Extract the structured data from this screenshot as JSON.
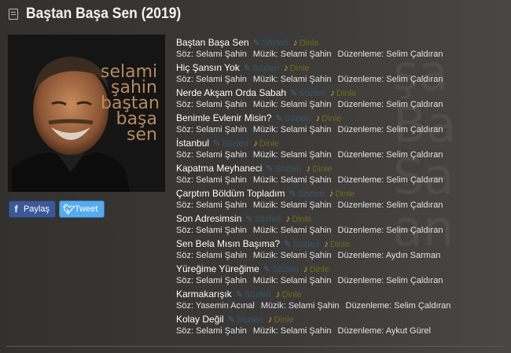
{
  "album": {
    "title": "Baştan Başa Sen (2019)",
    "cover_lines": [
      "selami",
      "şahin",
      "baştan",
      "başa",
      "sen"
    ],
    "background_lines": [
      "şa",
      "Ba",
      "Sa",
      "an"
    ]
  },
  "share": {
    "facebook_label": "Paylaş",
    "twitter_label": "Tweet"
  },
  "labels": {
    "lyrics": "Sözleri",
    "listen": "Dinle"
  },
  "tracks": [
    {
      "title": "Baştan Başa Sen",
      "soz": "Söz: Selami Şahin",
      "muzik": "Müzik: Selami Şahin",
      "duzenleme": "Düzenleme: Selim Çaldıran"
    },
    {
      "title": "Hiç Şansın Yok",
      "soz": "Söz: Selami Şahin",
      "muzik": "Müzik: Selami Şahin",
      "duzenleme": "Düzenleme: Selim Çaldıran"
    },
    {
      "title": "Nerde Akşam Orda Sabah",
      "soz": "Söz: Selami Şahin",
      "muzik": "Müzik: Selami Şahin",
      "duzenleme": "Düzenleme: Selim Çaldıran"
    },
    {
      "title": "Benimle Evlenir Misin?",
      "soz": "Söz: Selami Şahin",
      "muzik": "Müzik: Selami Şahin",
      "duzenleme": "Düzenleme: Selim Çaldıran"
    },
    {
      "title": "İstanbul",
      "soz": "Söz: Selami Şahin",
      "muzik": "Müzik: Selami Şahin",
      "duzenleme": "Düzenleme: Selim Çaldıran"
    },
    {
      "title": "Kapatma Meyhaneci",
      "soz": "Söz: Selami Şahin",
      "muzik": "Müzik: Selami Şahin",
      "duzenleme": "Düzenleme: Selim Çaldıran"
    },
    {
      "title": "Çarptım Böldüm Topladım",
      "soz": "Söz: Selami Şahin",
      "muzik": "Müzik: Selami Şahin",
      "duzenleme": "Düzenleme: Selim Çaldıran"
    },
    {
      "title": "Son Adresimsin",
      "soz": "Söz: Selami Şahin",
      "muzik": "Müzik: Selami Şahin",
      "duzenleme": "Düzenleme: Selim Çaldıran"
    },
    {
      "title": "Sen Bela Mısın Başıma?",
      "soz": "Söz: Selami Şahin",
      "muzik": "Müzik: Selami Şahin",
      "duzenleme": "Düzenleme: Aydın Sarman"
    },
    {
      "title": "Yüreğime Yüreğime",
      "soz": "Söz: Selami Şahin",
      "muzik": "Müzik: Selami Şahin",
      "duzenleme": "Düzenleme: Selim Çaldıran"
    },
    {
      "title": "Karmakarışık",
      "soz": "Söz: Yasemin Acınal",
      "muzik": "Müzik: Selami Şahin",
      "duzenleme": "Düzenleme: Selim Çaldıran"
    },
    {
      "title": "Kolay Değil",
      "soz": "Söz: Selami Şahin",
      "muzik": "Müzik: Selami Şahin",
      "duzenleme": "Düzenleme: Aykut Gürel"
    }
  ],
  "colors": {
    "background": "#3a3836",
    "title_text": "#f2f2f2",
    "lyrics_link": "#2b6f8f",
    "listen_link": "#6f6a1a",
    "facebook": "#3b5998",
    "twitter": "#55acee"
  },
  "icons": {
    "header": "album-icon",
    "lyrics": "pen-icon",
    "listen": "music-note-icon",
    "facebook": "facebook-icon",
    "twitter": "twitter-icon"
  }
}
